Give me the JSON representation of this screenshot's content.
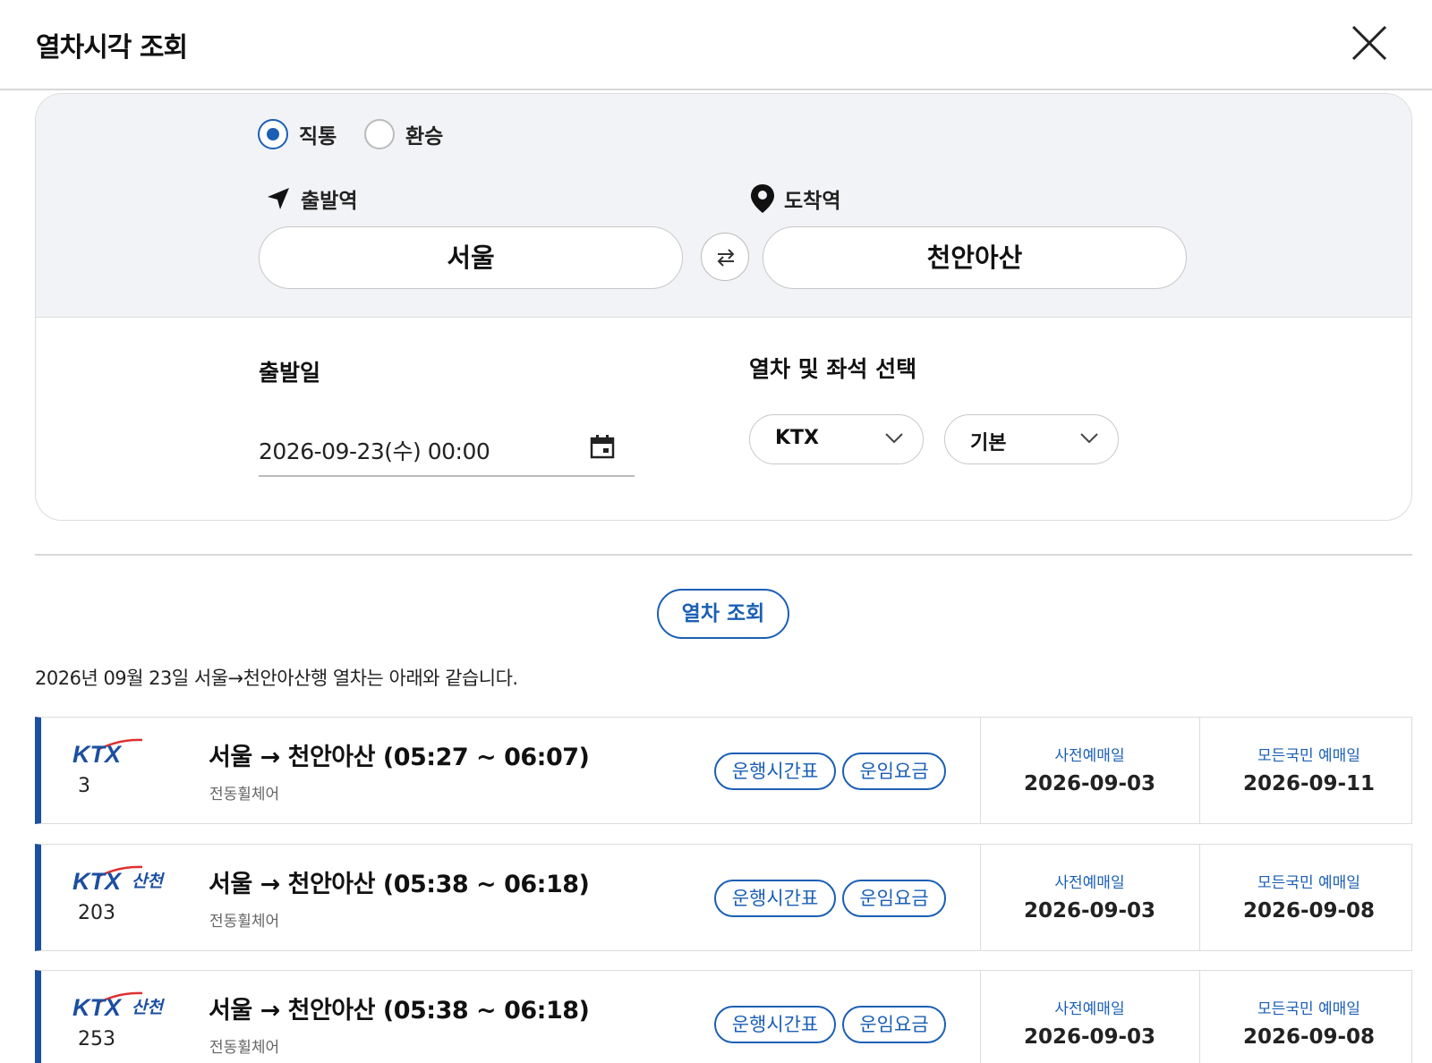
{
  "header": {
    "title": "열차시각 조회"
  },
  "search": {
    "trip_types": [
      "직통",
      "환승"
    ],
    "departure_label": "출발역",
    "arrival_label": "도착역",
    "departure_station": "서울",
    "arrival_station": "천안아산",
    "date_label": "출발일",
    "date_value": "2026-09-23(수) 00:00",
    "train_seat_label": "열차 및 좌석 선택",
    "train_type": "KTX",
    "seat_type": "기본"
  },
  "query_button": "열차 조회",
  "summary": "2026년 09월 23일 서울→천안아산행 열차는 아래와 같습니다.",
  "buttons": {
    "timetable": "운행시간표",
    "fare": "운임요금"
  },
  "col_labels": {
    "advance": "사전예매일",
    "public": "모든국민 예매일"
  },
  "trains": [
    {
      "logo_main": "KTX",
      "logo_sub": "",
      "number": "3",
      "route": "서울 → 천안아산 (05:27 ~ 06:07)",
      "info": "전동휠체어",
      "advance": "2026-09-03",
      "public": "2026-09-11"
    },
    {
      "logo_main": "KTX",
      "logo_sub": "산천",
      "number": "203",
      "route": "서울 → 천안아산 (05:38 ~ 06:18)",
      "info": "전동휠체어",
      "advance": "2026-09-03",
      "public": "2026-09-08"
    },
    {
      "logo_main": "KTX",
      "logo_sub": "산천",
      "number": "253",
      "route": "서울 → 천안아산 (05:38 ~ 06:18)",
      "info": "전동휠체어",
      "advance": "2026-09-03",
      "public": "2026-09-08"
    }
  ],
  "colors": {
    "accent": "#1b5fb5",
    "card_bar": "#1b4fa0",
    "logo": "#1b4fa0",
    "logo_swoosh": "#e03030"
  },
  "icons": [
    "close-icon",
    "navigation-arrow-icon",
    "location-pin-icon",
    "swap-icon",
    "calendar-icon",
    "chevron-down-icon"
  ]
}
